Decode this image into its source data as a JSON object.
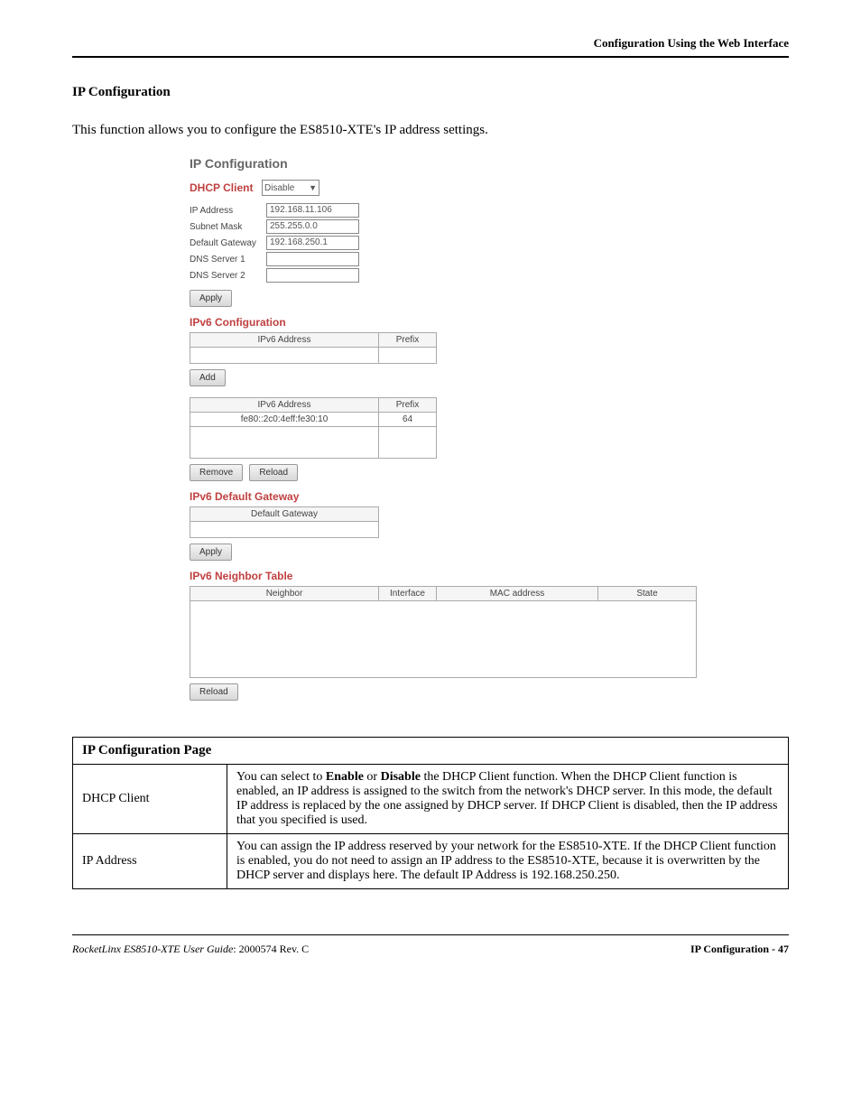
{
  "header": "Configuration Using the Web Interface",
  "section_title": "IP Configuration",
  "intro": "This function allows you to configure the ES8510-XTE's IP address settings.",
  "screenshot": {
    "title": "IP Configuration",
    "dhcp_label": "DHCP Client",
    "dhcp_value": "Disable",
    "fields": {
      "ip_label": "IP Address",
      "ip_value": "192.168.11.106",
      "mask_label": "Subnet Mask",
      "mask_value": "255.255.0.0",
      "gw_label": "Default Gateway",
      "gw_value": "192.168.250.1",
      "dns1_label": "DNS Server 1",
      "dns1_value": "",
      "dns2_label": "DNS Server 2",
      "dns2_value": ""
    },
    "buttons": {
      "apply": "Apply",
      "add": "Add",
      "remove": "Remove",
      "reload": "Reload"
    },
    "ipv6_config_title": "IPv6 Configuration",
    "ipv6_addr_header": "IPv6 Address",
    "prefix_header": "Prefix",
    "ipv6_row_addr": "fe80::2c0:4eff:fe30:10",
    "ipv6_row_prefix": "64",
    "ipv6_gw_title": "IPv6 Default Gateway",
    "default_gw_header": "Default Gateway",
    "ipv6_neighbor_title": "IPv6 Neighbor Table",
    "neighbor_headers": {
      "neighbor": "Neighbor",
      "interface": "Interface",
      "mac": "MAC address",
      "state": "State"
    }
  },
  "info_table": {
    "title": "IP Configuration Page",
    "rows": [
      {
        "label": "DHCP Client",
        "desc_pre": "You can select to ",
        "desc_enable": "Enable",
        "desc_or": " or ",
        "desc_disable": "Disable",
        "desc_post": " the DHCP Client function. When the DHCP Client function is enabled, an IP address is assigned to the switch from the network's DHCP server. In this mode, the default IP address is replaced by the one assigned by DHCP server. If DHCP Client is disabled, then the IP address that you specified is used."
      },
      {
        "label": "IP Address",
        "desc": "You can assign the IP address reserved by your network for the ES8510-XTE. If the DHCP Client function is enabled, you do not need to assign an IP address to the ES8510-XTE, because it is overwritten by the DHCP server and displays here. The default IP Address is 192.168.250.250."
      }
    ]
  },
  "footer": {
    "guide": "RocketLinx ES8510-XTE User Guide",
    "rev": ": 2000574 Rev. C",
    "right": "IP Configuration - 47"
  }
}
